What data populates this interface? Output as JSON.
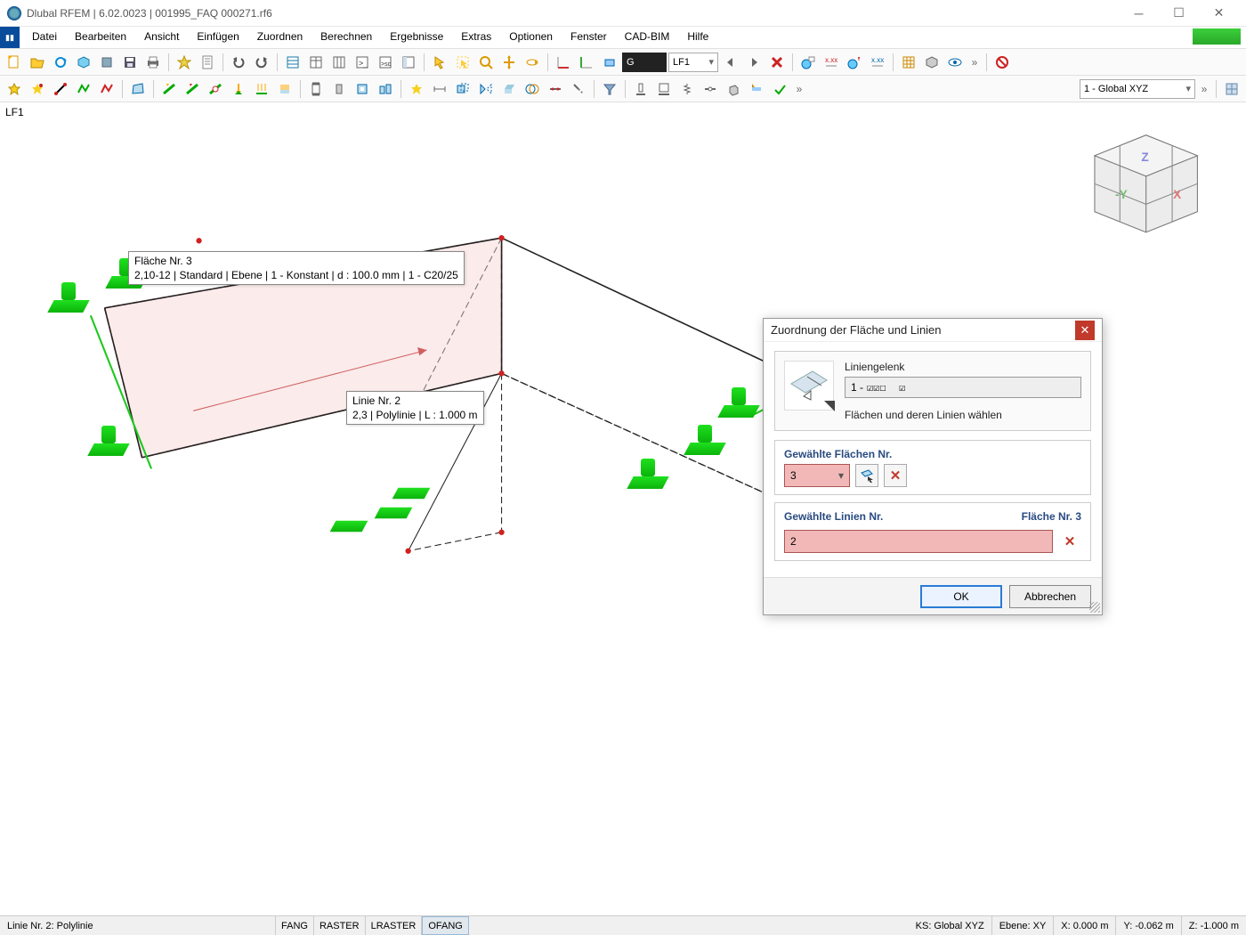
{
  "title": "Dlubal RFEM | 6.02.0023 | 001995_FAQ 000271.rf6",
  "menus": [
    "Datei",
    "Bearbeiten",
    "Ansicht",
    "Einfügen",
    "Zuordnen",
    "Berechnen",
    "Ergebnisse",
    "Extras",
    "Optionen",
    "Fenster",
    "CAD-BIM",
    "Hilfe"
  ],
  "toolbar1": {
    "loadcase_g": "G",
    "loadcase_lf": "LF1"
  },
  "toolbar2": {
    "coord_system": "1 - Global XYZ"
  },
  "viewport": {
    "lf_label": "LF1",
    "tooltip_surface": {
      "line1": "Fläche Nr. 3",
      "line2": "2,10-12 | Standard | Ebene | 1 - Konstant | d : 100.0 mm | 1 - C20/25"
    },
    "tooltip_line": {
      "line1": "Linie Nr. 2",
      "line2": "2,3 | Polylinie | L : 1.000 m"
    }
  },
  "dialog": {
    "title": "Zuordnung der Fläche und Linien",
    "group_label": "Liniengelenk",
    "group_value": "1 -",
    "hint": "Flächen und deren Linien wählen",
    "sec_surfaces": "Gewählte Flächen Nr.",
    "surfaces_value": "3",
    "sec_lines": "Gewählte Linien Nr.",
    "sec_lines_right": "Fläche Nr. 3",
    "lines_value": "2",
    "ok": "OK",
    "cancel": "Abbrechen"
  },
  "status": {
    "left": "Linie Nr. 2: Polylinie",
    "toggles": [
      "FANG",
      "RASTER",
      "LRASTER",
      "OFANG"
    ],
    "ks": "KS: Global XYZ",
    "ebene": "Ebene: XY",
    "x": "X: 0.000 m",
    "y": "Y: -0.062 m",
    "z": "Z: -1.000 m"
  }
}
